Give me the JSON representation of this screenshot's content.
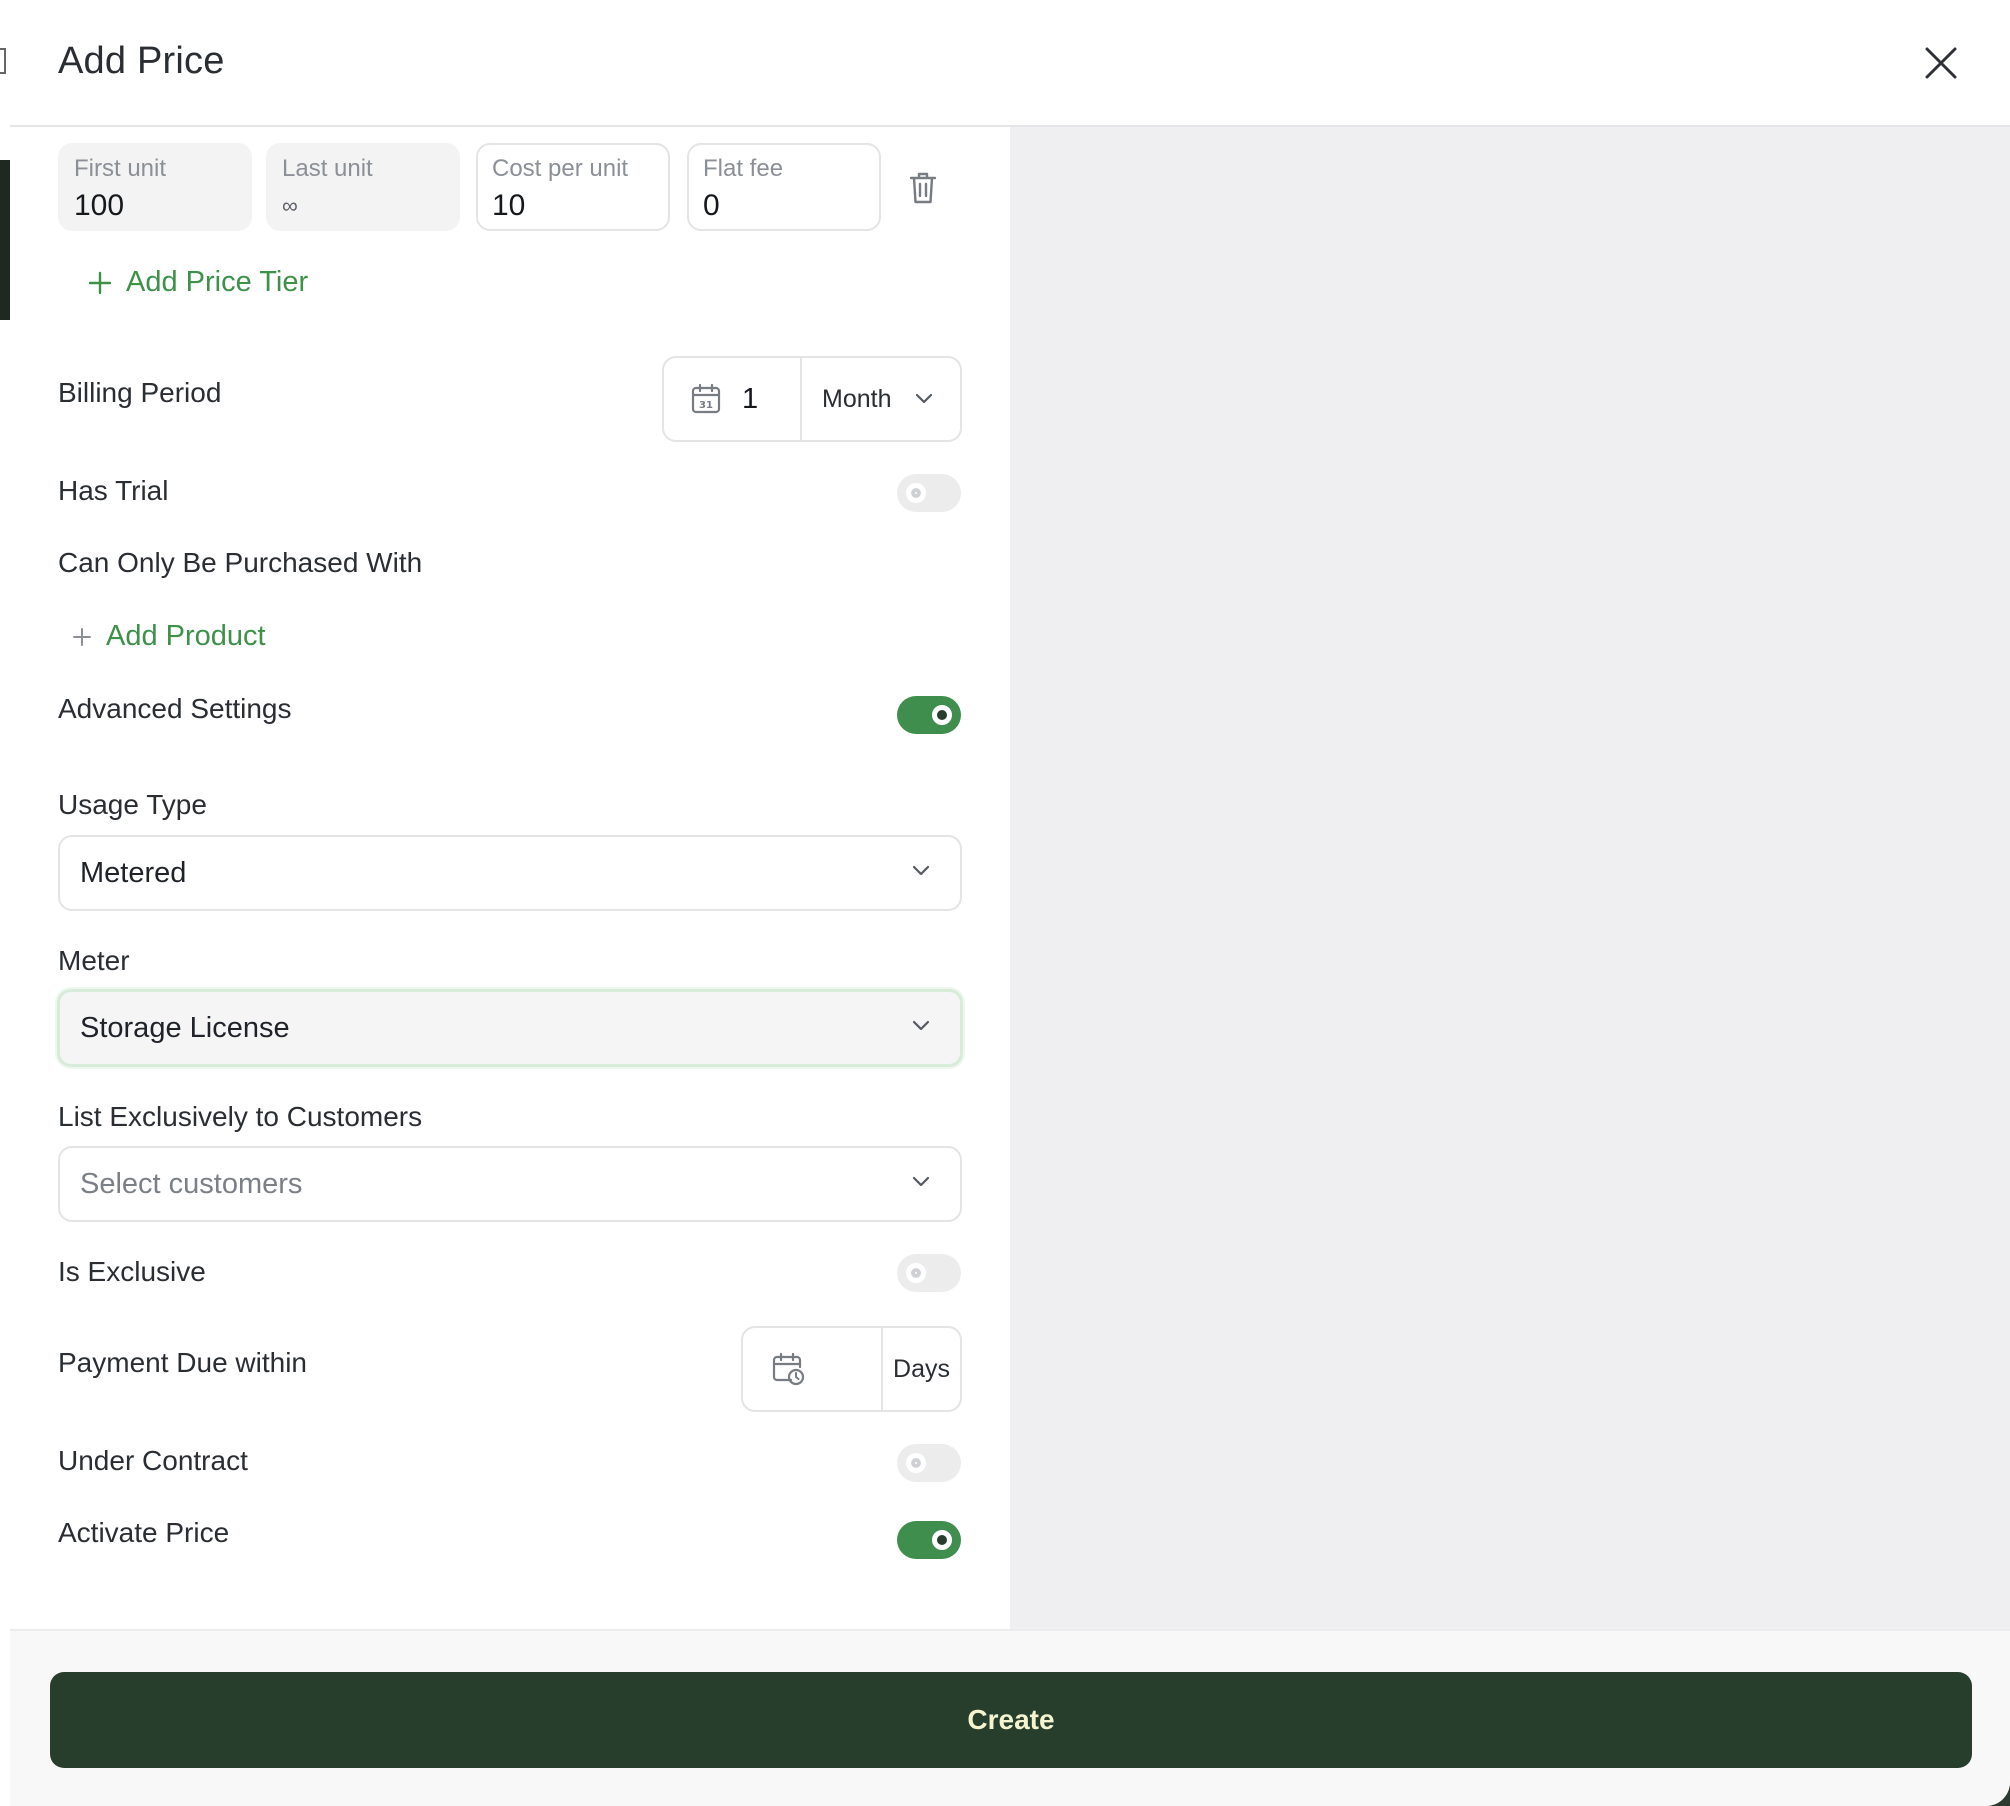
{
  "header": {
    "title": "Add Price"
  },
  "tier": {
    "first_unit_label": "First unit",
    "first_unit_value": "100",
    "last_unit_label": "Last unit",
    "last_unit_value": "∞",
    "cost_label": "Cost per unit",
    "cost_value": "10",
    "flat_label": "Flat fee",
    "flat_value": "0"
  },
  "add_tier_label": "Add Price Tier",
  "billing": {
    "label": "Billing Period",
    "count": "1",
    "unit": "Month"
  },
  "has_trial": {
    "label": "Has Trial",
    "on": false
  },
  "purchased_with": {
    "label": "Can Only Be Purchased With",
    "add_label": "Add Product"
  },
  "advanced": {
    "label": "Advanced Settings",
    "on": true
  },
  "usage_type": {
    "label": "Usage Type",
    "value": "Metered"
  },
  "meter": {
    "label": "Meter",
    "value": "Storage License"
  },
  "customers": {
    "label": "List Exclusively to Customers",
    "placeholder": "Select customers"
  },
  "is_exclusive": {
    "label": "Is Exclusive",
    "on": false
  },
  "payment_due": {
    "label": "Payment Due within",
    "unit": "Days"
  },
  "under_contract": {
    "label": "Under Contract",
    "on": false
  },
  "activate": {
    "label": "Activate Price",
    "on": true
  },
  "footer": {
    "create_label": "Create"
  },
  "colors": {
    "accent": "#3f8e4d",
    "primary_button": "#283e2d",
    "link": "#3d9149"
  }
}
